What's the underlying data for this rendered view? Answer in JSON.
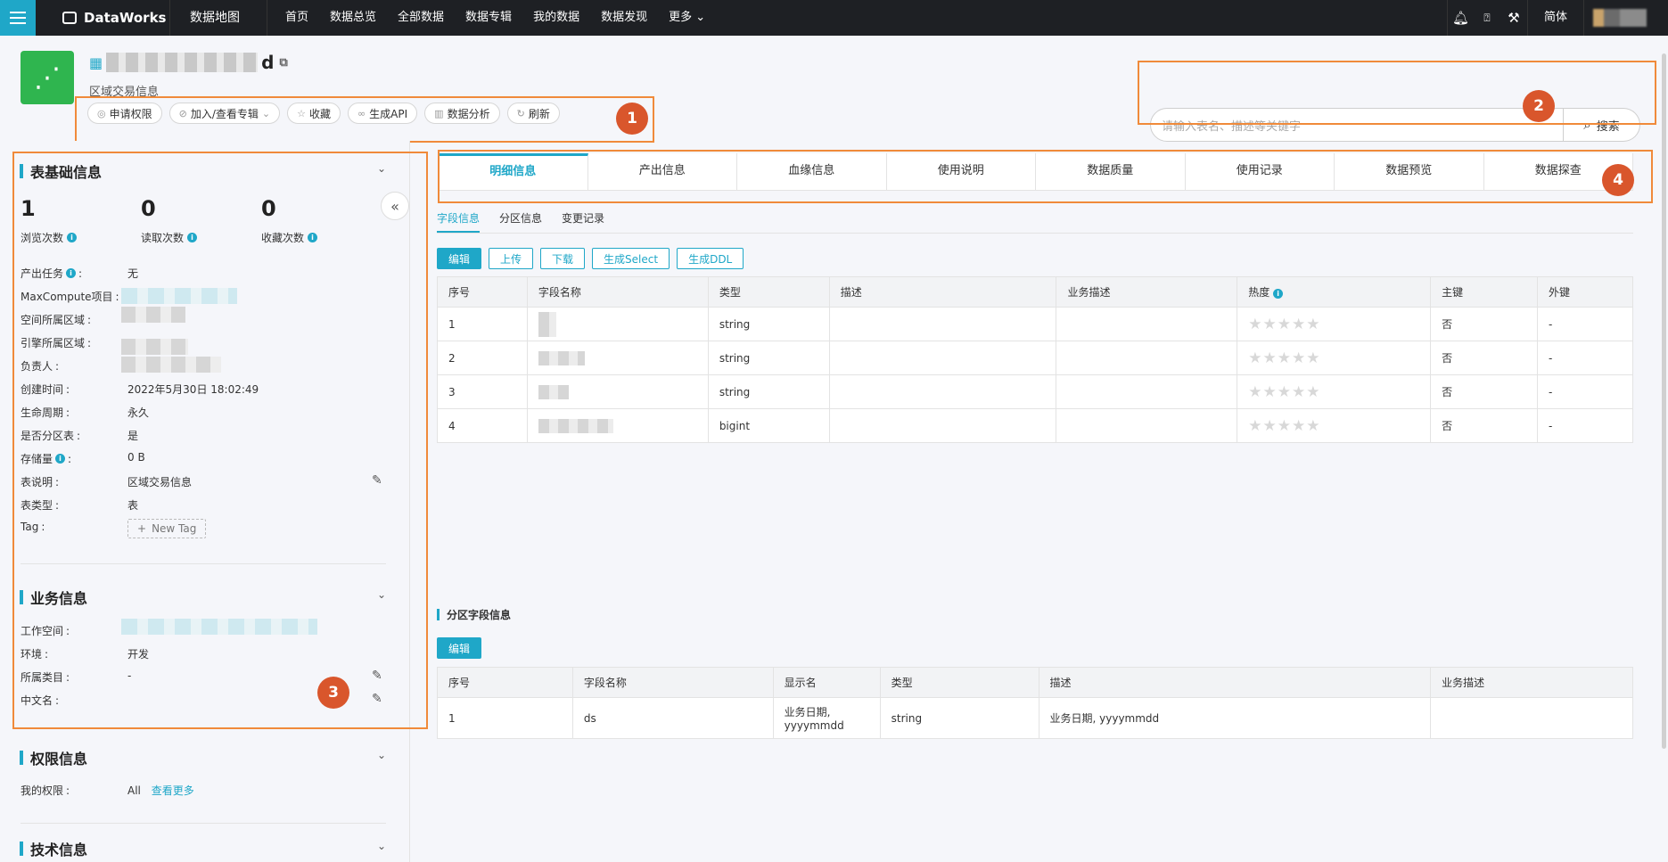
{
  "topnav": {
    "brand": "DataWorks",
    "section": "数据地图",
    "items": [
      "首页",
      "数据总览",
      "全部数据",
      "数据专辑",
      "我的数据",
      "数据发现",
      "更多"
    ],
    "lang": "简体"
  },
  "header": {
    "table_name_suffix": "d",
    "table_desc": "区域交易信息",
    "actions": [
      {
        "icon": "lock-icon",
        "label": "申请权限"
      },
      {
        "icon": "album-icon",
        "label": "加入/查看专辑"
      },
      {
        "icon": "star-icon",
        "label": "收藏"
      },
      {
        "icon": "link-icon",
        "label": "生成API"
      },
      {
        "icon": "chart-icon",
        "label": "数据分析"
      },
      {
        "icon": "refresh-icon",
        "label": "刷新"
      }
    ],
    "search": {
      "placeholder": "请输入表名、描述等关键字",
      "button": "搜索"
    }
  },
  "callouts": [
    "1",
    "2",
    "3",
    "4"
  ],
  "left": {
    "basic": {
      "title": "表基础信息",
      "stats": [
        {
          "value": "1",
          "label": "浏览次数"
        },
        {
          "value": "0",
          "label": "读取次数"
        },
        {
          "value": "0",
          "label": "收藏次数"
        }
      ],
      "fields": [
        {
          "label": "产出任务",
          "value": "无"
        },
        {
          "label": "MaxCompute项目",
          "value": ""
        },
        {
          "label": "空间所属区域",
          "value": ""
        },
        {
          "label": "引擎所属区域",
          "value": ""
        },
        {
          "label": "负责人",
          "value": ""
        },
        {
          "label": "创建时间",
          "value": "2022年5月30日 18:02:49"
        },
        {
          "label": "生命周期",
          "value": "永久"
        },
        {
          "label": "是否分区表",
          "value": "是"
        },
        {
          "label": "存储量",
          "value": "0 B"
        },
        {
          "label": "表说明",
          "value": "区域交易信息"
        },
        {
          "label": "表类型",
          "value": "表"
        },
        {
          "label": "Tag",
          "value": "New Tag"
        }
      ]
    },
    "business": {
      "title": "业务信息",
      "fields": [
        {
          "label": "工作空间",
          "value": ""
        },
        {
          "label": "环境",
          "value": "开发"
        },
        {
          "label": "所属类目",
          "value": "-"
        },
        {
          "label": "中文名",
          "value": ""
        }
      ]
    },
    "permission": {
      "title": "权限信息",
      "label": "我的权限",
      "value": "All",
      "link": "查看更多"
    },
    "tech": {
      "title": "技术信息"
    }
  },
  "main": {
    "tabs": [
      "明细信息",
      "产出信息",
      "血缘信息",
      "使用说明",
      "数据质量",
      "使用记录",
      "数据预览",
      "数据探查"
    ],
    "subtabs": [
      "字段信息",
      "分区信息",
      "变更记录"
    ],
    "buttons": [
      "编辑",
      "上传",
      "下载",
      "生成Select",
      "生成DDL"
    ],
    "fields_table": {
      "headers": [
        "序号",
        "字段名称",
        "类型",
        "描述",
        "业务描述",
        "热度",
        "主键",
        "外键"
      ],
      "rows": [
        {
          "no": "1",
          "type": "string",
          "pk": "否",
          "fk": "-"
        },
        {
          "no": "2",
          "type": "string",
          "pk": "否",
          "fk": "-"
        },
        {
          "no": "3",
          "type": "string",
          "pk": "否",
          "fk": "-"
        },
        {
          "no": "4",
          "type": "bigint",
          "pk": "否",
          "fk": "-"
        }
      ]
    },
    "partition": {
      "title": "分区字段信息",
      "edit": "编辑",
      "headers": [
        "序号",
        "字段名称",
        "显示名",
        "类型",
        "描述",
        "业务描述"
      ],
      "rows": [
        {
          "no": "1",
          "name": "ds",
          "display_name": "业务日期, yyyymmdd",
          "type": "string",
          "desc": "业务日期, yyyymmdd",
          "biz": ""
        }
      ]
    }
  }
}
